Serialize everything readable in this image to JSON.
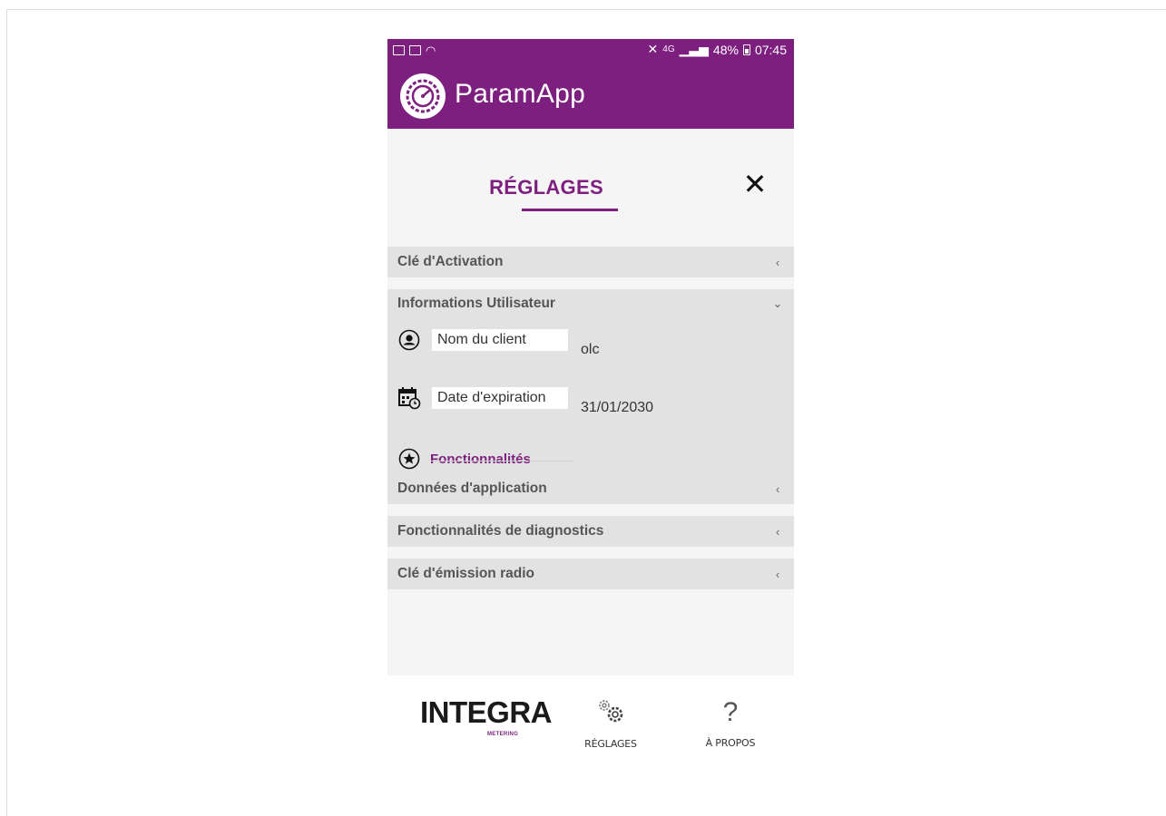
{
  "status_bar": {
    "left_icons": [
      "image-icon",
      "mail-icon",
      "wifi-icon"
    ],
    "signal_text": "4G",
    "battery": "48%",
    "time": "07:45"
  },
  "app": {
    "title": "ParamApp",
    "accent_color": "#7d1f7f"
  },
  "panel": {
    "title": "RÉGLAGES",
    "sections": [
      {
        "label": "Clé d'Activation",
        "expanded": false
      },
      {
        "label": "Informations Utilisateur",
        "expanded": true
      },
      {
        "label": "Données d'application",
        "expanded": false
      },
      {
        "label": "Fonctionnalités de diagnostics",
        "expanded": false
      },
      {
        "label": "Clé d'émission radio",
        "expanded": false
      }
    ],
    "user_info": {
      "client_label": "Nom du client",
      "client_value": "olc",
      "expiry_label": "Date d'expiration",
      "expiry_value": "31/01/2030",
      "features_label": "Fonctionnalités"
    }
  },
  "bottom_nav": {
    "brand_name": "INTEGRA",
    "brand_sub": "METERING",
    "settings_label": "RÉGLAGES",
    "about_label": "À PROPOS",
    "about_glyph": "?"
  }
}
